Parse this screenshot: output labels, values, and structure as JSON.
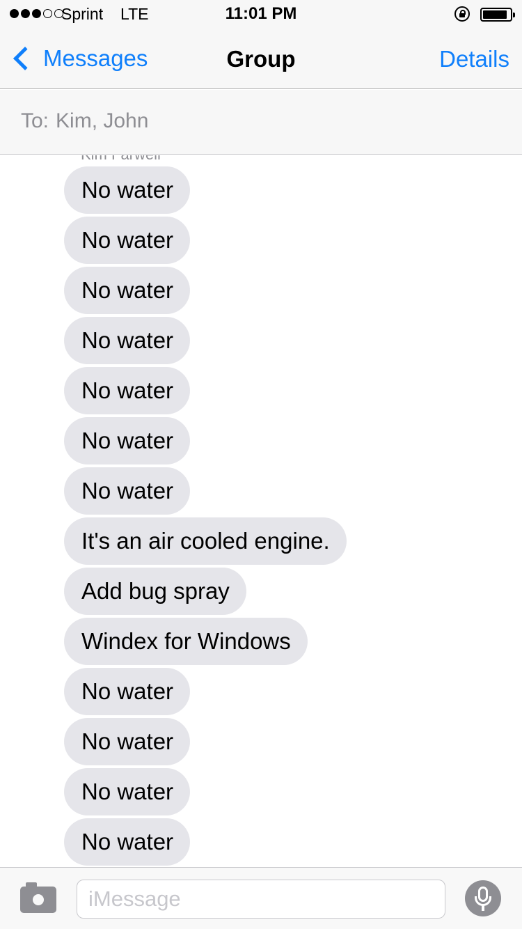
{
  "status_bar": {
    "carrier": "Sprint",
    "network": "LTE",
    "time": "11:01 PM",
    "signal_bars_filled": 3,
    "signal_bars_total": 5,
    "icons": [
      "orientation-lock-icon",
      "battery-icon"
    ]
  },
  "nav": {
    "back_label": "Messages",
    "title": "Group",
    "details_label": "Details"
  },
  "recipients": {
    "prefix": "To:",
    "names": "Kim, John"
  },
  "conversation": {
    "sender_name": "Kim Farwell",
    "messages": [
      {
        "text": "No water"
      },
      {
        "text": "No water"
      },
      {
        "text": "No water"
      },
      {
        "text": "No water"
      },
      {
        "text": "No water"
      },
      {
        "text": "No water"
      },
      {
        "text": "No water"
      },
      {
        "text": "It's an air cooled engine."
      },
      {
        "text": "Add bug spray"
      },
      {
        "text": "Windex for Windows"
      },
      {
        "text": "No water"
      },
      {
        "text": "No water"
      },
      {
        "text": "No water"
      },
      {
        "text": "No water"
      }
    ]
  },
  "composer": {
    "placeholder": "iMessage",
    "value": "",
    "icons": [
      "camera-icon",
      "microphone-icon"
    ]
  },
  "colors": {
    "accent": "#0f7ffb",
    "incoming_bubble": "#e5e5ea",
    "secondary_text": "#8e8e93",
    "bar_background": "#f7f7f7"
  }
}
